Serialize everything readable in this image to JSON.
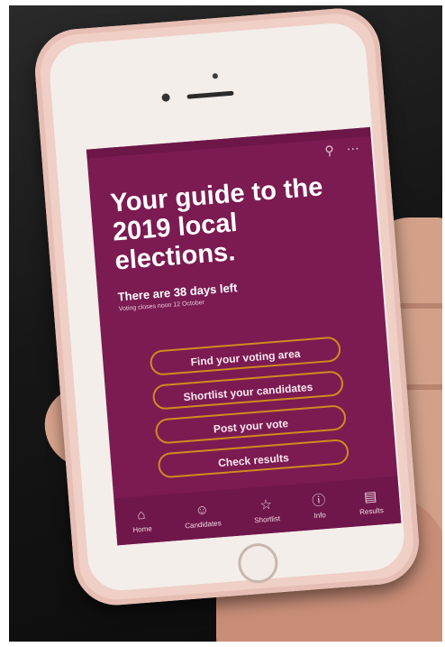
{
  "header": {
    "zoom_icon": "zoom-in-icon",
    "more_icon": "more-icon"
  },
  "hero": {
    "headline": "Your guide to the 2019 local elections.",
    "days_left": "There are 38 days left",
    "closes": "Voting closes noon 12 October"
  },
  "actions": [
    {
      "label": "Find your voting area"
    },
    {
      "label": "Shortlist your candidates"
    },
    {
      "label": "Post your vote"
    },
    {
      "label": "Check results"
    }
  ],
  "tabs": [
    {
      "label": "Home",
      "icon": "home-icon"
    },
    {
      "label": "Candidates",
      "icon": "person-icon"
    },
    {
      "label": "Shortlist",
      "icon": "star-icon"
    },
    {
      "label": "Info",
      "icon": "info-icon"
    },
    {
      "label": "Results",
      "icon": "chart-icon"
    }
  ],
  "colors": {
    "screen_bg": "#7b1b52",
    "button_border": "#d28a1e",
    "case": "#efcfc6"
  }
}
